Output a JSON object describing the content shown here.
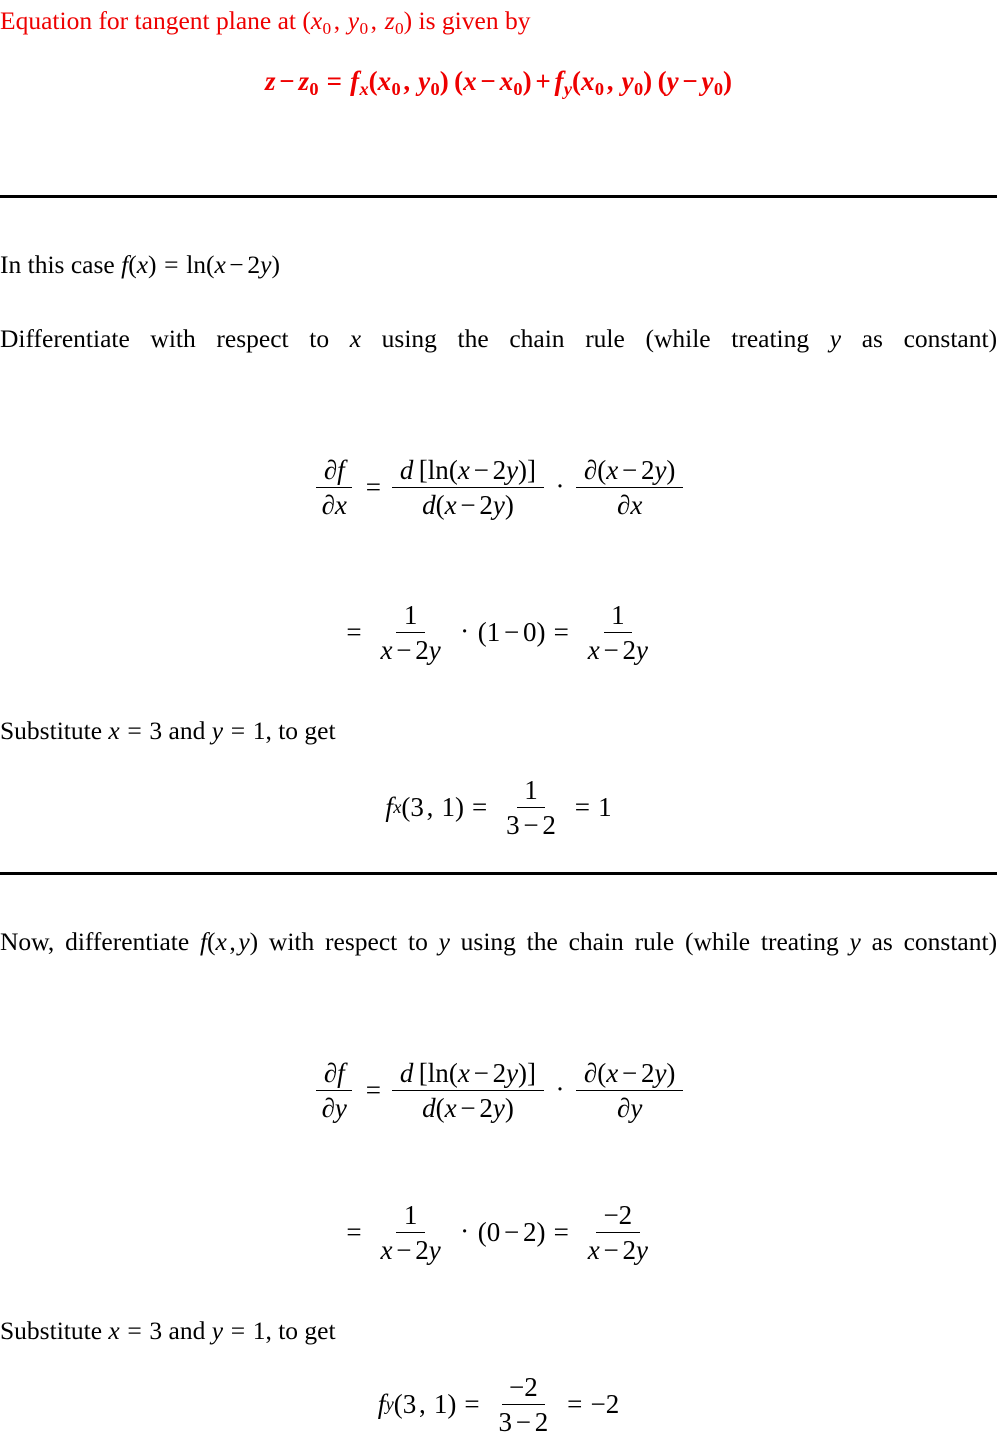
{
  "document": {
    "type": "math-worksheet",
    "topic": "Tangent plane and partial derivatives",
    "text_color": "#000000",
    "accent_color": "#ee0000",
    "background_color": "#ffffff"
  },
  "header": {
    "intro_prefix": "Equation for tangent plane at",
    "intro_point": "(x₀, y₀, z₀)",
    "intro_suffix": "is given by",
    "formula_plain": "z − z₀ = fₓ(x₀,y₀)(x − x₀) + fᵧ(x₀,y₀)(y − y₀)",
    "formula": {
      "lhs_var": "z",
      "minus": "−",
      "lhs_sub": "z",
      "lhs_sub_index": "0",
      "equals": "=",
      "fx_base": "f",
      "fx_sub": "x",
      "fy_base": "f",
      "fy_sub": "y",
      "point_x": "x",
      "point_y": "y",
      "point_sub": "0",
      "plus": "+",
      "var_x": "x",
      "var_y": "y"
    }
  },
  "section_x": {
    "case_line_prefix": "In this case",
    "case_function": "f(x) = ln(x − 2y)",
    "instruction": "Differentiate with respect to x using the chain rule (while treating y as constant)",
    "instruction_parts": {
      "p1": "Differentiate",
      "p2": "with",
      "p3": "respect",
      "p4": "to",
      "var_a": "x",
      "p5": "using",
      "p6": "the",
      "p7": "chain",
      "p8": "rule",
      "p9": "(while",
      "p10": "treating",
      "var_b": "y",
      "p11": "as",
      "p12": "constant)"
    },
    "chain_rule_equation": "∂f/∂x = d[ln(x − 2y)]/d(x − 2y) · ∂(x − 2y)/∂x",
    "chain_rule": {
      "lhs_num": "∂f",
      "lhs_den": "∂x",
      "mid_num": "d [ln(x − 2y)]",
      "mid_den": "d(x − 2y)",
      "right_num": "∂(x − 2y)",
      "right_den": "∂x"
    },
    "simplified_equation": "= 1/(x − 2y) · (1 − 0) = 1/(x − 2y)",
    "simplified": {
      "frac1_num": "1",
      "frac1_den": "x − 2y",
      "factor": "(1 − 0)",
      "frac2_num": "1",
      "frac2_den": "x − 2y"
    },
    "substitute_line": "Substitute x = 3 and y = 1, to get",
    "substitute_parts": {
      "lead": "Substitute",
      "x_assign": "x = 3",
      "conj": "and",
      "y_assign": "y = 1",
      "tail": ", to get"
    },
    "result_equation": "fₓ(3,1) = 1/(3 − 2) = 1",
    "result": {
      "func_base": "f",
      "func_sub": "x",
      "args": "(3, 1)",
      "frac_num": "1",
      "frac_den": "3 − 2",
      "value": "1"
    }
  },
  "section_y": {
    "instruction": "Now, differentiate f(x,y) with respect to y using the chain rule (while treating y as constant)",
    "instruction_parts": {
      "p1": "Now,",
      "p2": "differentiate",
      "func": "f(x,y)",
      "p3": "with",
      "p4": "respect",
      "p5": "to",
      "var_a": "y",
      "p6": "using",
      "p7": "the",
      "p8": "chain",
      "p9": "rule",
      "p10": "(while",
      "p11": "treating",
      "var_b": "y",
      "p12": "as",
      "p13": "constant)"
    },
    "chain_rule_equation": "∂f/∂y = d[ln(x − 2y)]/d(x − 2y) · ∂(x − 2y)/∂y",
    "chain_rule": {
      "lhs_num": "∂f",
      "lhs_den": "∂y",
      "mid_num": "d [ln(x − 2y)]",
      "mid_den": "d(x − 2y)",
      "right_num": "∂(x − 2y)",
      "right_den": "∂y"
    },
    "simplified_equation": "= 1/(x − 2y) · (0 − 2) = −2/(x − 2y)",
    "simplified": {
      "frac1_num": "1",
      "frac1_den": "x − 2y",
      "factor": "(0 − 2)",
      "frac2_num": "−2",
      "frac2_den": "x − 2y"
    },
    "substitute_line": "Substitute x = 3 and y = 1, to get",
    "substitute_parts": {
      "lead": "Substitute",
      "x_assign": "x = 3",
      "conj": "and",
      "y_assign": "y = 1",
      "tail": ", to get"
    },
    "result_equation": "fᵧ(3,1) = −2/(3 − 2) = −2",
    "result": {
      "func_base": "f",
      "func_sub": "y",
      "args": "(3, 1)",
      "frac_num": "−2",
      "frac_den": "3 − 2",
      "value": "−2"
    }
  },
  "dividers": {
    "rule_1_label": "horizontal-rule-top",
    "rule_2_label": "horizontal-rule-middle"
  },
  "symbols": {
    "cdot": "·",
    "equals": "=",
    "minus": "−",
    "partial": "∂"
  }
}
